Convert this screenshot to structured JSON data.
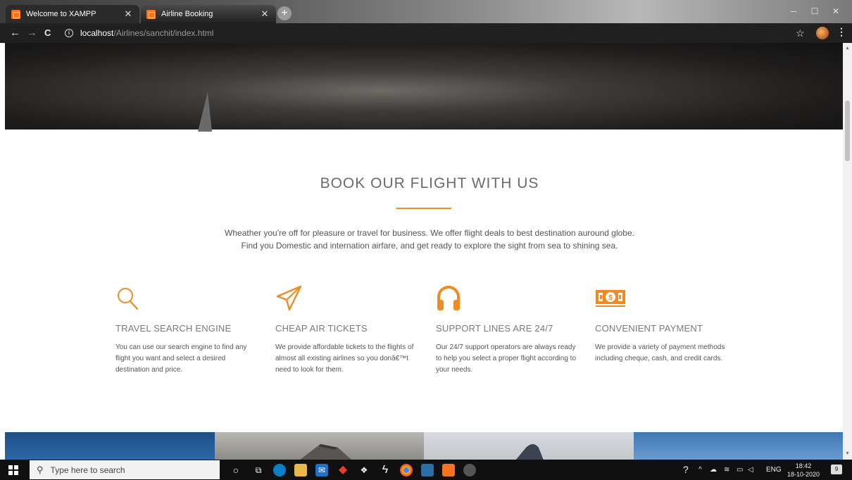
{
  "browser": {
    "tabs": [
      {
        "title": "Welcome to XAMPP",
        "active": false
      },
      {
        "title": "Airline Booking",
        "active": true
      }
    ],
    "new_tab": "+",
    "url_host": "localhost",
    "url_path": "/Airlines/sanchit/index.html",
    "back": "←",
    "forward": "→",
    "reload": "C",
    "star": "☆",
    "menu": "⋮",
    "window_controls": {
      "minimize": "─",
      "maximize": "☐",
      "close": "✕"
    }
  },
  "section": {
    "title": "BOOK OUR FLIGHT WITH US",
    "intro_line1": "Wheather you're off for pleasure or travel for business. We offer flight deals to best destination auround globe.",
    "intro_line2": "Find you Domestic and internation airfare, and get ready to explore the sight from sea to shining sea."
  },
  "features": [
    {
      "icon": "search-icon",
      "title": "TRAVEL SEARCH ENGINE",
      "desc": "You can use our search engine to find any flight you want and select a desired destination and price."
    },
    {
      "icon": "paper-plane-icon",
      "title": "CHEAP AIR TICKETS",
      "desc": "We provide affordable tickets to the flights of almost all existing airlines so you donâ€™t need to look for them."
    },
    {
      "icon": "headphones-icon",
      "title": "SUPPORT LINES ARE 24/7",
      "desc": "Our 24/7 support operators are always ready to help you select a proper flight according to your needs."
    },
    {
      "icon": "money-icon",
      "title": "CONVENIENT PAYMENT",
      "desc": "We provide a variety of payment methods including cheque, cash, and credit cards."
    }
  ],
  "colors": {
    "accent": "#f08a24",
    "title": "#6b6b6b",
    "text": "#555555"
  },
  "taskbar": {
    "search_placeholder": "Type here to search",
    "language": "ENG",
    "time": "18:42",
    "date": "18-10-2020",
    "notification_count": "9"
  }
}
